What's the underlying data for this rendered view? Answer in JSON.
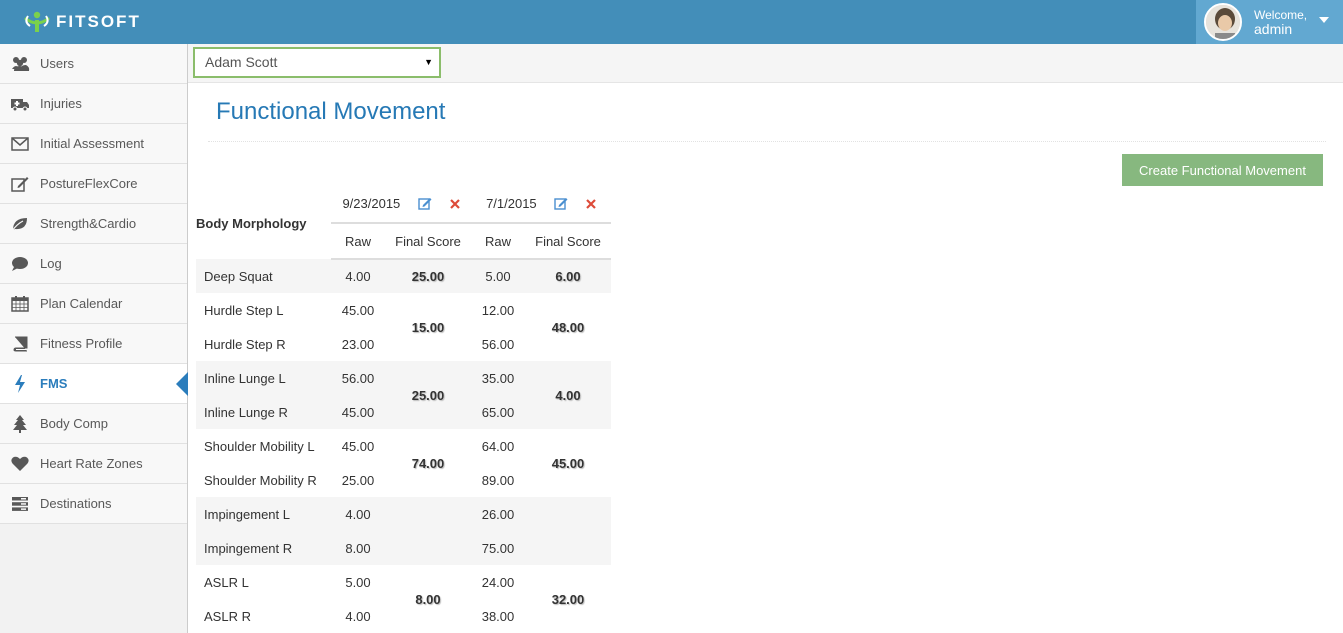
{
  "app": {
    "brand": "FITSOFT"
  },
  "user": {
    "welcome": "Welcome,",
    "name": "admin"
  },
  "sidebar": {
    "items": [
      {
        "label": "Users",
        "icon": "users-icon"
      },
      {
        "label": "Injuries",
        "icon": "ambulance-icon"
      },
      {
        "label": "Initial Assessment",
        "icon": "envelope-icon"
      },
      {
        "label": "PostureFlexCore",
        "icon": "pencil-square-icon"
      },
      {
        "label": "Strength&Cardio",
        "icon": "leaf-icon"
      },
      {
        "label": "Log",
        "icon": "comment-icon"
      },
      {
        "label": "Plan Calendar",
        "icon": "calendar-icon"
      },
      {
        "label": "Fitness Profile",
        "icon": "book-icon"
      },
      {
        "label": "FMS",
        "icon": "bolt-icon",
        "active": true
      },
      {
        "label": "Body Comp",
        "icon": "tree-icon"
      },
      {
        "label": "Heart Rate Zones",
        "icon": "heart-icon"
      },
      {
        "label": "Destinations",
        "icon": "list-icon"
      }
    ]
  },
  "selector": {
    "value": "Adam Scott"
  },
  "page": {
    "title": "Functional Movement",
    "create_label": "Create Functional Movement"
  },
  "table": {
    "header_name": "Body Morphology",
    "dates": [
      "9/23/2015",
      "7/1/2015"
    ],
    "sub_raw": "Raw",
    "sub_final": "Final Score",
    "rows": [
      {
        "name": "Deep Squat",
        "raw1": "4.00",
        "raw2": "5.00"
      },
      {
        "name": "Hurdle Step L",
        "raw1": "45.00",
        "raw2": "12.00"
      },
      {
        "name": "Hurdle Step R",
        "raw1": "23.00",
        "raw2": "56.00"
      },
      {
        "name": "Inline Lunge L",
        "raw1": "56.00",
        "raw2": "35.00"
      },
      {
        "name": "Inline Lunge R",
        "raw1": "45.00",
        "raw2": "65.00"
      },
      {
        "name": "Shoulder Mobility L",
        "raw1": "45.00",
        "raw2": "64.00"
      },
      {
        "name": "Shoulder Mobility R",
        "raw1": "25.00",
        "raw2": "89.00"
      },
      {
        "name": "Impingement L",
        "raw1": "4.00",
        "raw2": "26.00"
      },
      {
        "name": "Impingement R",
        "raw1": "8.00",
        "raw2": "75.00"
      },
      {
        "name": "ASLR L",
        "raw1": "5.00",
        "raw2": "24.00"
      },
      {
        "name": "ASLR R",
        "raw1": "4.00",
        "raw2": "38.00"
      }
    ],
    "finals": {
      "deep_squat": [
        "25.00",
        "6.00"
      ],
      "hurdle_step": [
        "15.00",
        "48.00"
      ],
      "inline_lunge": [
        "25.00",
        "4.00"
      ],
      "shoulder_mobility": [
        "74.00",
        "45.00"
      ],
      "aslr": [
        "8.00",
        "32.00"
      ]
    }
  }
}
